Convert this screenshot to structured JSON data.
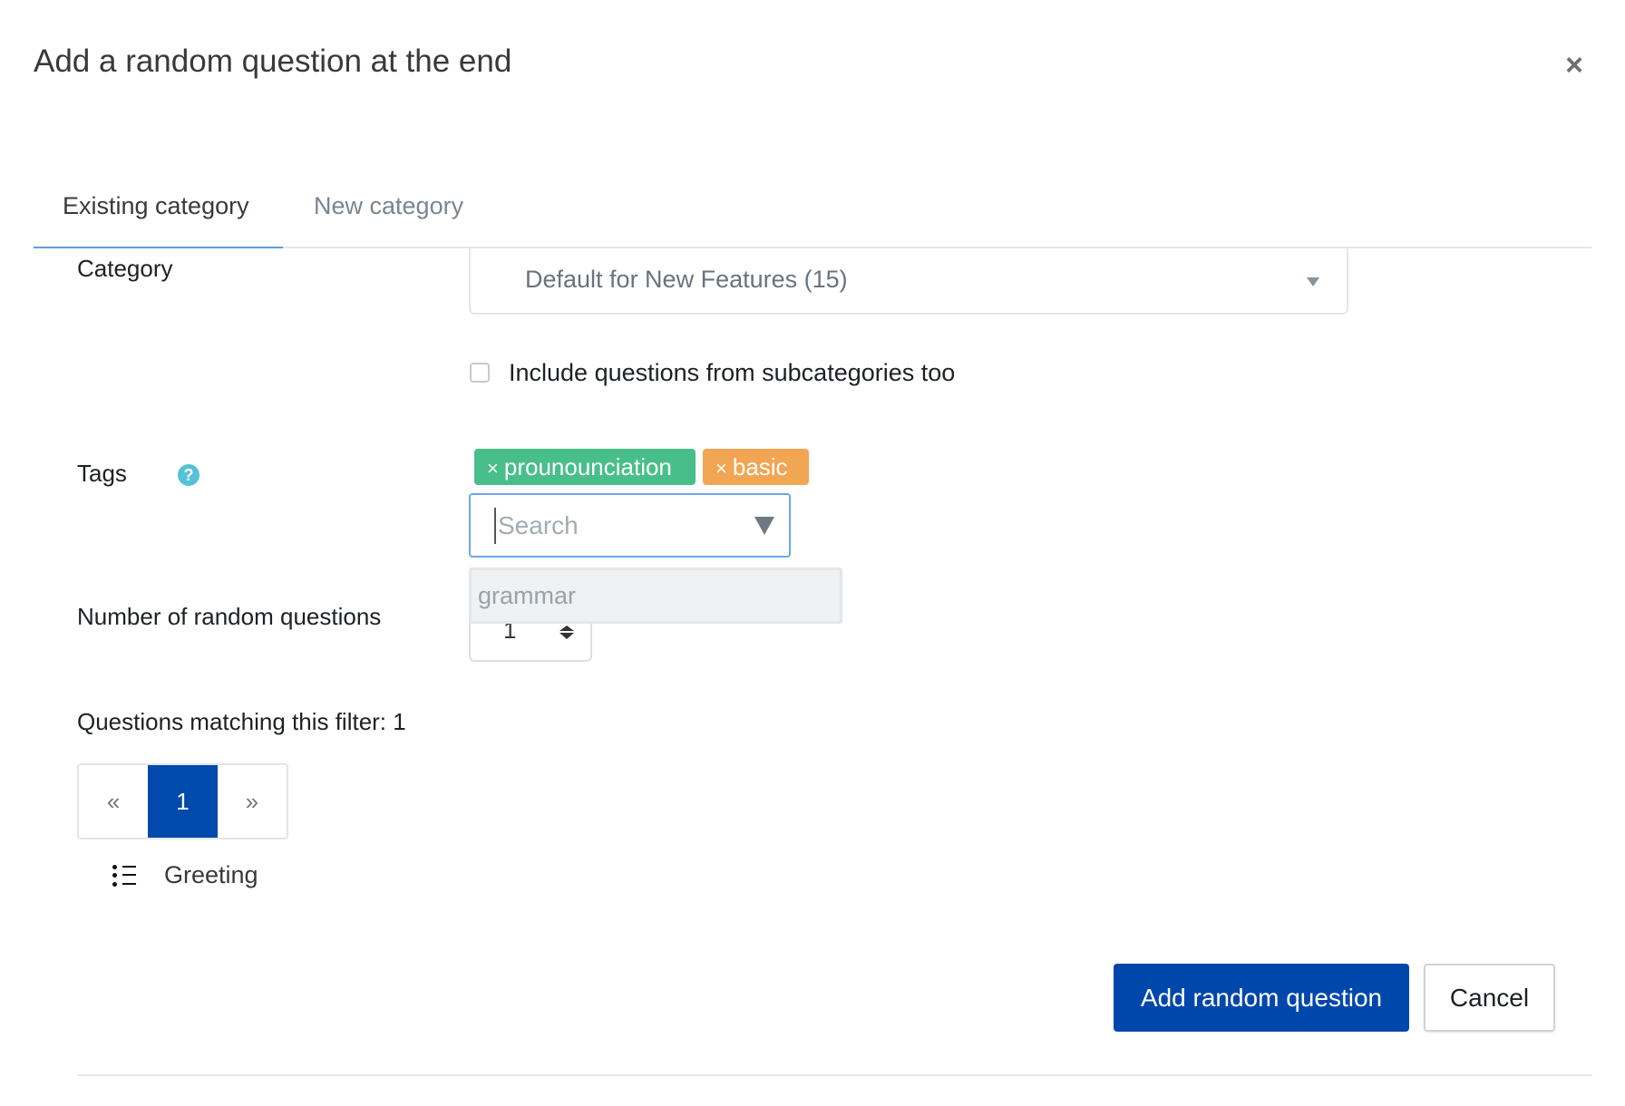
{
  "dialog": {
    "title": "Add a random question at the end",
    "close_icon": "close-icon"
  },
  "tabs": [
    {
      "label": "Existing category",
      "active": true
    },
    {
      "label": "New category",
      "active": false
    }
  ],
  "form": {
    "category": {
      "label": "Category",
      "selected": "Default for New Features (15)"
    },
    "include_subcategories": {
      "label": "Include questions from subcategories too",
      "checked": false
    },
    "tags": {
      "label": "Tags",
      "help_icon": "?",
      "selected": [
        {
          "remove": "×",
          "label": "prounounciation",
          "color": "#48bf8a"
        },
        {
          "remove": "×",
          "label": "basic",
          "color": "#f2a553"
        }
      ],
      "search_placeholder": "Search",
      "search_value": "",
      "suggestions": [
        "grammar"
      ]
    },
    "number_of_random_questions": {
      "label": "Number of random questions",
      "value": "1"
    }
  },
  "matching": {
    "label": "Questions matching this filter: 1",
    "pagination": {
      "prev": "«",
      "current": "1",
      "next": "»"
    },
    "questions": [
      "Greeting"
    ]
  },
  "footer": {
    "primary_label": "Add random question",
    "cancel_label": "Cancel"
  },
  "colors": {
    "primary": "#0047ab",
    "tab_active_underline": "#5e9ddd",
    "tag_green": "#48bf8a",
    "tag_orange": "#f2a553",
    "help": "#56c2d6"
  }
}
